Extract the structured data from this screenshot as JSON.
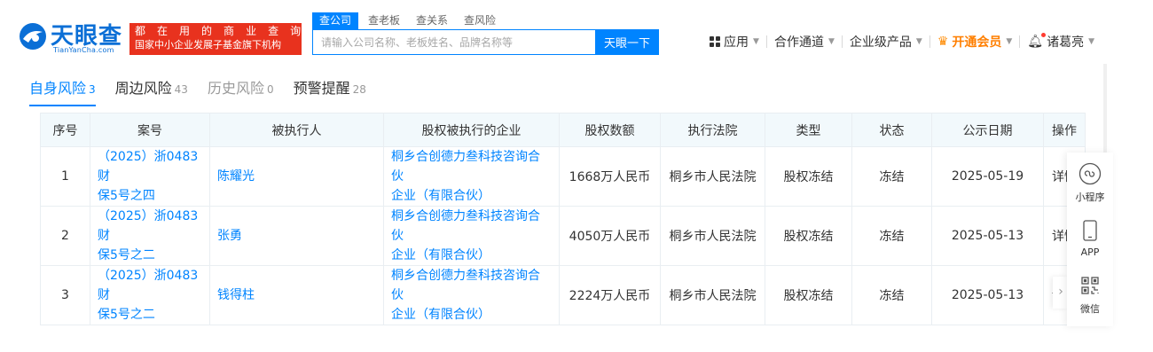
{
  "brand": {
    "name_cn": "天眼查",
    "name_en": "TianYanCha.com",
    "slogan_line1": "都 在 用 的 商 业 查 询 工 具",
    "slogan_line2": "国家中小企业发展子基金旗下机构",
    "colors": {
      "primary": "#0084ff",
      "slogan_bg": "#e8321e",
      "vip": "#ff7f00"
    }
  },
  "search": {
    "tabs": [
      "查公司",
      "查老板",
      "查关系",
      "查风险"
    ],
    "active_tab": "查公司",
    "placeholder": "请输入公司名称、老板姓名、品牌名称等",
    "button": "天眼一下"
  },
  "top_nav": {
    "app": "应用",
    "channel": "合作通道",
    "enterprise": "企业级产品",
    "vip": "开通会员",
    "user": "诸葛亮"
  },
  "risk_tabs": [
    {
      "label": "自身风险",
      "count": "3",
      "state": "active"
    },
    {
      "label": "周边风险",
      "count": "43",
      "state": "normal"
    },
    {
      "label": "历史风险",
      "count": "0",
      "state": "muted"
    },
    {
      "label": "预警提醒",
      "count": "28",
      "state": "warn"
    }
  ],
  "table": {
    "headers": [
      "序号",
      "案号",
      "被执行人",
      "股权被执行的企业",
      "股权数额",
      "执行法院",
      "类型",
      "状态",
      "公示日期",
      "操作"
    ],
    "rows": [
      {
        "index": "1",
        "case_line1": "（2025）浙0483财",
        "case_line2": "保5号之四",
        "person": "陈耀光",
        "company_line1": "桐乡合创德力叁科技咨询合伙",
        "company_line2": "企业（有限合伙）",
        "amount": "1668万人民币",
        "court": "桐乡市人民法院",
        "type": "股权冻结",
        "status": "冻结",
        "date": "2025-05-19",
        "op": "详情"
      },
      {
        "index": "2",
        "case_line1": "（2025）浙0483财",
        "case_line2": "保5号之二",
        "person": "张勇",
        "company_line1": "桐乡合创德力叁科技咨询合伙",
        "company_line2": "企业（有限合伙）",
        "amount": "4050万人民币",
        "court": "桐乡市人民法院",
        "type": "股权冻结",
        "status": "冻结",
        "date": "2025-05-13",
        "op": "详情"
      },
      {
        "index": "3",
        "case_line1": "（2025）浙0483财",
        "case_line2": "保5号之二",
        "person": "钱得柱",
        "company_line1": "桐乡合创德力叁科技咨询合伙",
        "company_line2": "企业（有限合伙）",
        "amount": "2224万人民币",
        "court": "桐乡市人民法院",
        "type": "股权冻结",
        "status": "冻结",
        "date": "2025-05-13",
        "op": "详情"
      }
    ]
  },
  "float_bar": {
    "mini_program": "小程序",
    "app": "APP",
    "wechat": "微信",
    "collapse_icon": "chevron-right-icon"
  }
}
